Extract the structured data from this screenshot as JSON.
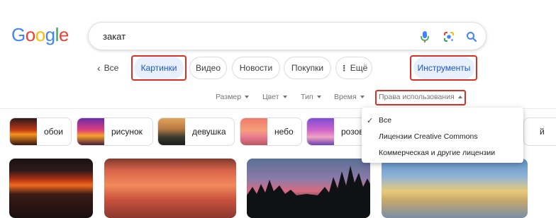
{
  "logo": {
    "letters": [
      "G",
      "o",
      "o",
      "g",
      "l",
      "e"
    ],
    "colors": [
      "#4285F4",
      "#EA4335",
      "#FBBC05",
      "#4285F4",
      "#34A853",
      "#EA4335"
    ]
  },
  "search": {
    "query": "закат",
    "icons": [
      "microphone-icon",
      "google-lens-icon",
      "search-icon"
    ]
  },
  "tabs": {
    "back_label": "Все",
    "items": [
      {
        "label": "Картинки",
        "active": true,
        "highlighted": true
      },
      {
        "label": "Видео",
        "active": false
      },
      {
        "label": "Новости",
        "active": false
      },
      {
        "label": "Покупки",
        "active": false
      },
      {
        "label": "Ещё",
        "active": false
      }
    ],
    "tools_label": "Инструменты"
  },
  "filters": {
    "items": [
      "Размер",
      "Цвет",
      "Тип",
      "Время"
    ],
    "rights_label": "Права использования"
  },
  "chips": [
    {
      "label": "обои"
    },
    {
      "label": "рисунок"
    },
    {
      "label": "девушка"
    },
    {
      "label": "небо"
    },
    {
      "label": "розов"
    },
    {
      "label": "й"
    }
  ],
  "dropdown": {
    "items": [
      {
        "label": "Все",
        "checked": true
      },
      {
        "label": "Лицензии Creative Commons",
        "checked": false
      },
      {
        "label": "Коммерческая и другие лицензии",
        "checked": false
      }
    ]
  },
  "colors": {
    "highlight": "#d93025",
    "active_tab_bg": "#e8f0fe",
    "active_tab_text": "#1a56c6"
  }
}
